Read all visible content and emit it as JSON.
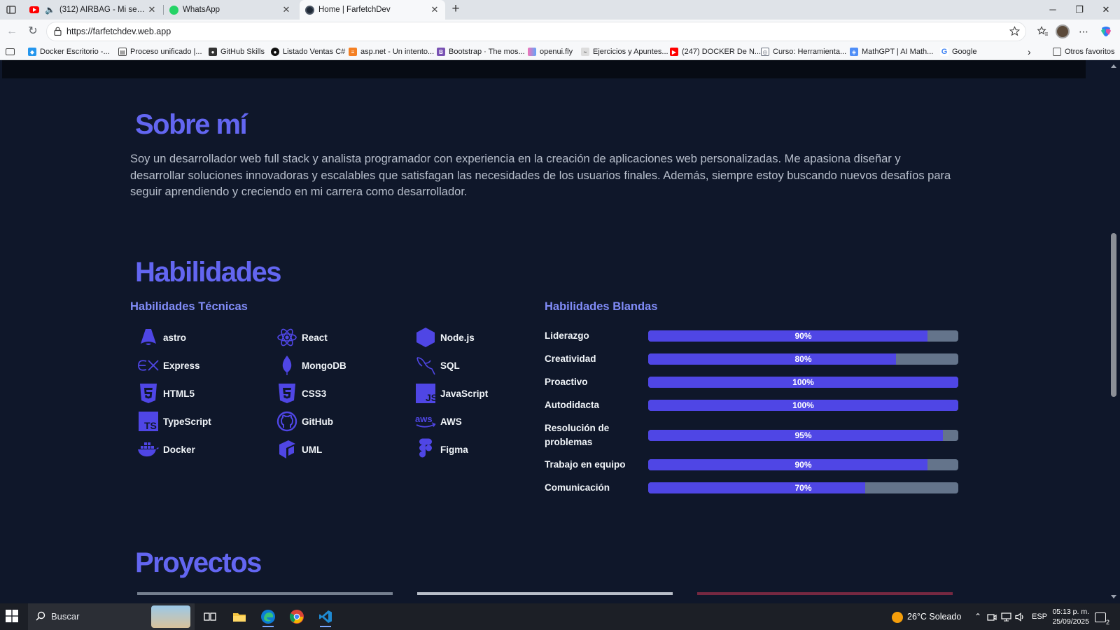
{
  "browser": {
    "tabs": [
      {
        "title": "(312) AIRBAG - Mi sensación",
        "icon": "youtube-icon",
        "audio": true
      },
      {
        "title": "WhatsApp",
        "icon": "whatsapp-icon"
      },
      {
        "title": "Home | FarfetchDev",
        "icon": "farfetchdev-icon",
        "active": true
      }
    ],
    "url": "https://farfetchdev.web.app",
    "bookmarks": [
      "Docker Escritorio -...",
      "Proceso unificado |...",
      "GitHub Skills",
      "Listado Ventas C#",
      "asp.net - Un intento...",
      "Bootstrap · The mos...",
      "openui.fly",
      "Ejercicios y Apuntes...",
      "(247) DOCKER De N...",
      "Curso: Herramienta...",
      "MathGPT | AI Math...",
      "Google"
    ],
    "other_favorites": "Otros favoritos"
  },
  "about": {
    "heading": "Sobre mí",
    "text": "Soy un desarrollador web full stack y analista programador con experiencia en la creación de aplicaciones web personalizadas. Me apasiona diseñar y desarrollar soluciones innovadoras y escalables que satisfagan las necesidades de los usuarios finales. Además, siempre estoy buscando nuevos desafíos para seguir aprendiendo y creciendo en mi carrera como desarrollador."
  },
  "skills": {
    "heading": "Habilidades",
    "technical_heading": "Habilidades Técnicas",
    "technical": [
      {
        "name": "astro",
        "icon": "astro-icon"
      },
      {
        "name": "React",
        "icon": "react-icon"
      },
      {
        "name": "Node.js",
        "icon": "nodejs-icon"
      },
      {
        "name": "Express",
        "icon": "express-icon"
      },
      {
        "name": "MongoDB",
        "icon": "mongodb-icon"
      },
      {
        "name": "SQL",
        "icon": "sql-icon"
      },
      {
        "name": "HTML5",
        "icon": "html5-icon"
      },
      {
        "name": "CSS3",
        "icon": "css3-icon"
      },
      {
        "name": "JavaScript",
        "icon": "javascript-icon"
      },
      {
        "name": "TypeScript",
        "icon": "typescript-icon"
      },
      {
        "name": "GitHub",
        "icon": "github-icon"
      },
      {
        "name": "AWS",
        "icon": "aws-icon"
      },
      {
        "name": "Docker",
        "icon": "docker-icon"
      },
      {
        "name": "UML",
        "icon": "uml-icon"
      },
      {
        "name": "Figma",
        "icon": "figma-icon"
      }
    ],
    "soft_heading": "Habilidades Blandas",
    "soft": [
      {
        "name": "Liderazgo",
        "value": 90,
        "label": "90%"
      },
      {
        "name": "Creatividad",
        "value": 80,
        "label": "80%"
      },
      {
        "name": "Proactivo",
        "value": 100,
        "label": "100%"
      },
      {
        "name": "Autodidacta",
        "value": 100,
        "label": "100%"
      },
      {
        "name": "Resolución de problemas",
        "value": 95,
        "label": "95%"
      },
      {
        "name": "Trabajo en equipo",
        "value": 90,
        "label": "90%"
      },
      {
        "name": "Comunicación",
        "value": 70,
        "label": "70%"
      }
    ]
  },
  "projects": {
    "heading": "Proyectos"
  },
  "taskbar": {
    "search_placeholder": "Buscar",
    "weather": "26°C  Soleado",
    "language": "ESP",
    "time": "05:13 p. m.",
    "date": "25/09/2025",
    "notifications": "2"
  },
  "colors": {
    "page_bg": "#0f172a",
    "accent": "#6366f1",
    "bar_fill": "#4f46e5",
    "bar_track": "#64748b"
  }
}
